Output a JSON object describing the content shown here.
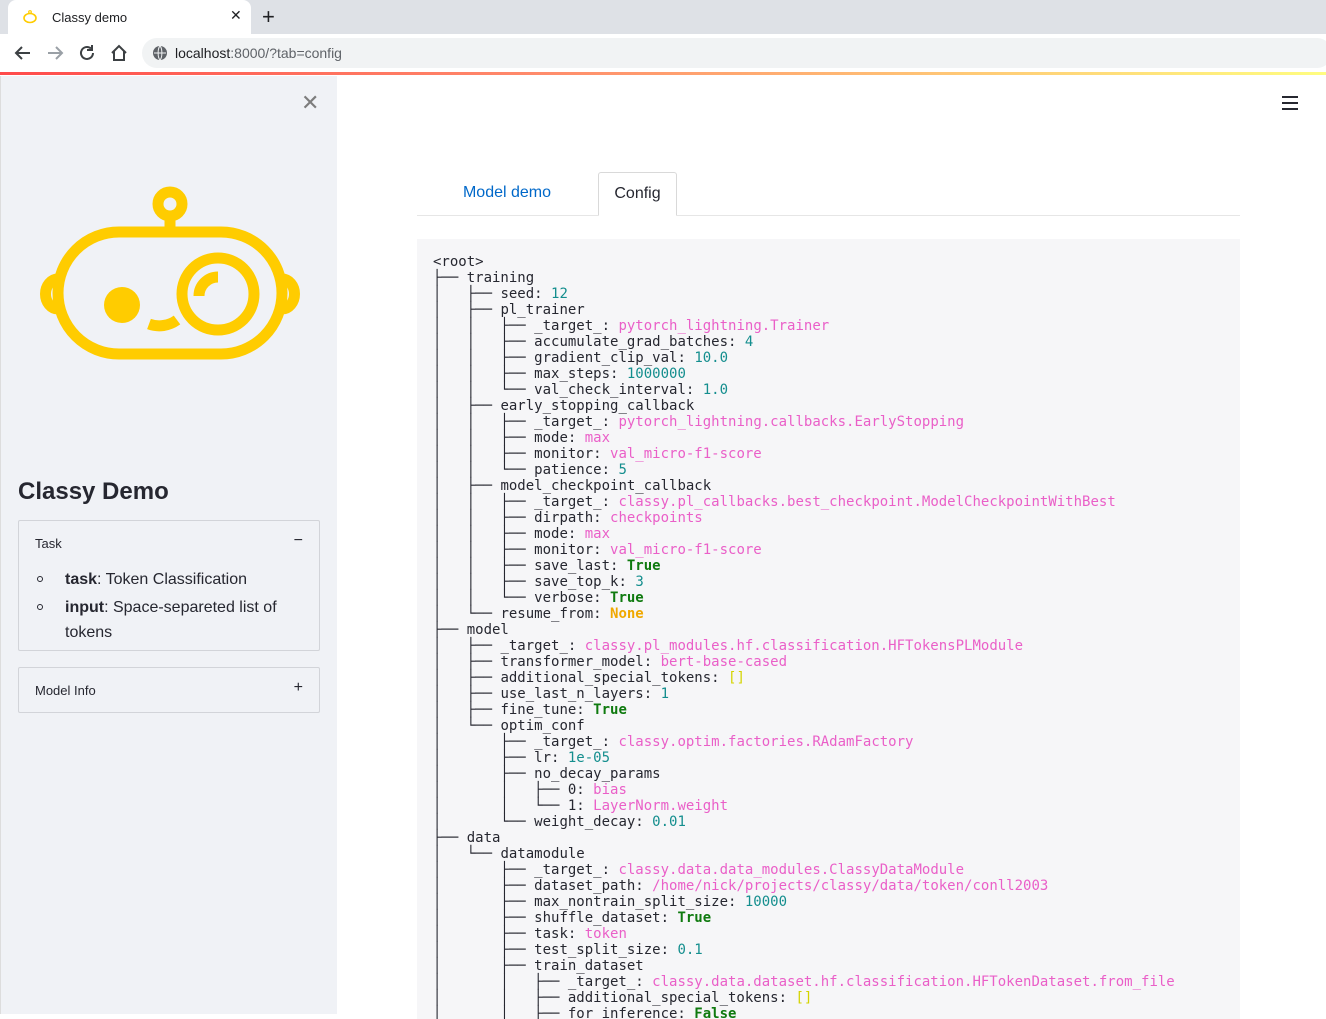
{
  "browser": {
    "tab_title": "Classy demo",
    "url_host": "localhost",
    "url_path": ":8000/?tab=config"
  },
  "sidebar": {
    "app_title": "Classy Demo",
    "task_expander": {
      "label": "Task",
      "icon": "minus-icon",
      "items": [
        {
          "key": "task",
          "value": ": Token Classification"
        },
        {
          "key": "input",
          "value": ": Space-separeted list of tokens"
        }
      ]
    },
    "model_info_expander": {
      "label": "Model Info",
      "icon": "plus-icon"
    }
  },
  "main": {
    "tabs": [
      {
        "label": "Model demo",
        "active": false
      },
      {
        "label": "Config",
        "active": true
      }
    ],
    "config_tree": [
      {
        "prefix": "",
        "key": "<root>",
        "value": "",
        "type": ""
      },
      {
        "prefix": "├── ",
        "key": "training",
        "value": "",
        "type": ""
      },
      {
        "prefix": "│   ├── ",
        "key": "seed: ",
        "value": "12",
        "type": "num"
      },
      {
        "prefix": "│   ├── ",
        "key": "pl_trainer",
        "value": "",
        "type": ""
      },
      {
        "prefix": "│   │   ├── ",
        "key": "_target_: ",
        "value": "pytorch_lightning.Trainer",
        "type": "str"
      },
      {
        "prefix": "│   │   ├── ",
        "key": "accumulate_grad_batches: ",
        "value": "4",
        "type": "num"
      },
      {
        "prefix": "│   │   ├── ",
        "key": "gradient_clip_val: ",
        "value": "10.0",
        "type": "num"
      },
      {
        "prefix": "│   │   ├── ",
        "key": "max_steps: ",
        "value": "1000000",
        "type": "num"
      },
      {
        "prefix": "│   │   └── ",
        "key": "val_check_interval: ",
        "value": "1.0",
        "type": "num"
      },
      {
        "prefix": "│   ├── ",
        "key": "early_stopping_callback",
        "value": "",
        "type": ""
      },
      {
        "prefix": "│   │   ├── ",
        "key": "_target_: ",
        "value": "pytorch_lightning.callbacks.EarlyStopping",
        "type": "str"
      },
      {
        "prefix": "│   │   ├── ",
        "key": "mode: ",
        "value": "max",
        "type": "str"
      },
      {
        "prefix": "│   │   ├── ",
        "key": "monitor: ",
        "value": "val_micro-f1-score",
        "type": "str"
      },
      {
        "prefix": "│   │   └── ",
        "key": "patience: ",
        "value": "5",
        "type": "num"
      },
      {
        "prefix": "│   ├── ",
        "key": "model_checkpoint_callback",
        "value": "",
        "type": ""
      },
      {
        "prefix": "│   │   ├── ",
        "key": "_target_: ",
        "value": "classy.pl_callbacks.best_checkpoint.ModelCheckpointWithBest",
        "type": "str"
      },
      {
        "prefix": "│   │   ├── ",
        "key": "dirpath: ",
        "value": "checkpoints",
        "type": "str"
      },
      {
        "prefix": "│   │   ├── ",
        "key": "mode: ",
        "value": "max",
        "type": "str"
      },
      {
        "prefix": "│   │   ├── ",
        "key": "monitor: ",
        "value": "val_micro-f1-score",
        "type": "str"
      },
      {
        "prefix": "│   │   ├── ",
        "key": "save_last: ",
        "value": "True",
        "type": "bool"
      },
      {
        "prefix": "│   │   ├── ",
        "key": "save_top_k: ",
        "value": "3",
        "type": "num"
      },
      {
        "prefix": "│   │   └── ",
        "key": "verbose: ",
        "value": "True",
        "type": "bool"
      },
      {
        "prefix": "│   └── ",
        "key": "resume_from: ",
        "value": "None",
        "type": "none"
      },
      {
        "prefix": "├── ",
        "key": "model",
        "value": "",
        "type": ""
      },
      {
        "prefix": "│   ├── ",
        "key": "_target_: ",
        "value": "classy.pl_modules.hf.classification.HFTokensPLModule",
        "type": "str"
      },
      {
        "prefix": "│   ├── ",
        "key": "transformer_model: ",
        "value": "bert-base-cased",
        "type": "str"
      },
      {
        "prefix": "│   ├── ",
        "key": "additional_special_tokens: ",
        "value": "[]",
        "type": "list"
      },
      {
        "prefix": "│   ├── ",
        "key": "use_last_n_layers: ",
        "value": "1",
        "type": "num"
      },
      {
        "prefix": "│   ├── ",
        "key": "fine_tune: ",
        "value": "True",
        "type": "bool"
      },
      {
        "prefix": "│   └── ",
        "key": "optim_conf",
        "value": "",
        "type": ""
      },
      {
        "prefix": "│       ├── ",
        "key": "_target_: ",
        "value": "classy.optim.factories.RAdamFactory",
        "type": "str"
      },
      {
        "prefix": "│       ├── ",
        "key": "lr: ",
        "value": "1e-05",
        "type": "num"
      },
      {
        "prefix": "│       ├── ",
        "key": "no_decay_params",
        "value": "",
        "type": ""
      },
      {
        "prefix": "│       │   ├── ",
        "key": "0: ",
        "value": "bias",
        "type": "str"
      },
      {
        "prefix": "│       │   └── ",
        "key": "1: ",
        "value": "LayerNorm.weight",
        "type": "str"
      },
      {
        "prefix": "│       └── ",
        "key": "weight_decay: ",
        "value": "0.01",
        "type": "num"
      },
      {
        "prefix": "├── ",
        "key": "data",
        "value": "",
        "type": ""
      },
      {
        "prefix": "│   └── ",
        "key": "datamodule",
        "value": "",
        "type": ""
      },
      {
        "prefix": "│       ├── ",
        "key": "_target_: ",
        "value": "classy.data.data_modules.ClassyDataModule",
        "type": "str"
      },
      {
        "prefix": "│       ├── ",
        "key": "dataset_path: ",
        "value": "/home/nick/projects/classy/data/token/conll2003",
        "type": "str"
      },
      {
        "prefix": "│       ├── ",
        "key": "max_nontrain_split_size: ",
        "value": "10000",
        "type": "num"
      },
      {
        "prefix": "│       ├── ",
        "key": "shuffle_dataset: ",
        "value": "True",
        "type": "bool"
      },
      {
        "prefix": "│       ├── ",
        "key": "task: ",
        "value": "token",
        "type": "str"
      },
      {
        "prefix": "│       ├── ",
        "key": "test_split_size: ",
        "value": "0.1",
        "type": "num"
      },
      {
        "prefix": "│       ├── ",
        "key": "train_dataset",
        "value": "",
        "type": ""
      },
      {
        "prefix": "│       │   ├── ",
        "key": "_target_: ",
        "value": "classy.data.dataset.hf.classification.HFTokenDataset.from_file",
        "type": "str"
      },
      {
        "prefix": "│       │   ├── ",
        "key": "additional_special_tokens: ",
        "value": "[]",
        "type": "list"
      },
      {
        "prefix": "│       │   ├── ",
        "key": "for_inference: ",
        "value": "False",
        "type": "bool"
      }
    ]
  },
  "colors": {
    "accent": "#ff4b4b",
    "logo": "#ffcc00",
    "string": "#ea5fc8",
    "number": "#148e8e",
    "bool": "#0f7a0f",
    "none": "#f0a800"
  }
}
